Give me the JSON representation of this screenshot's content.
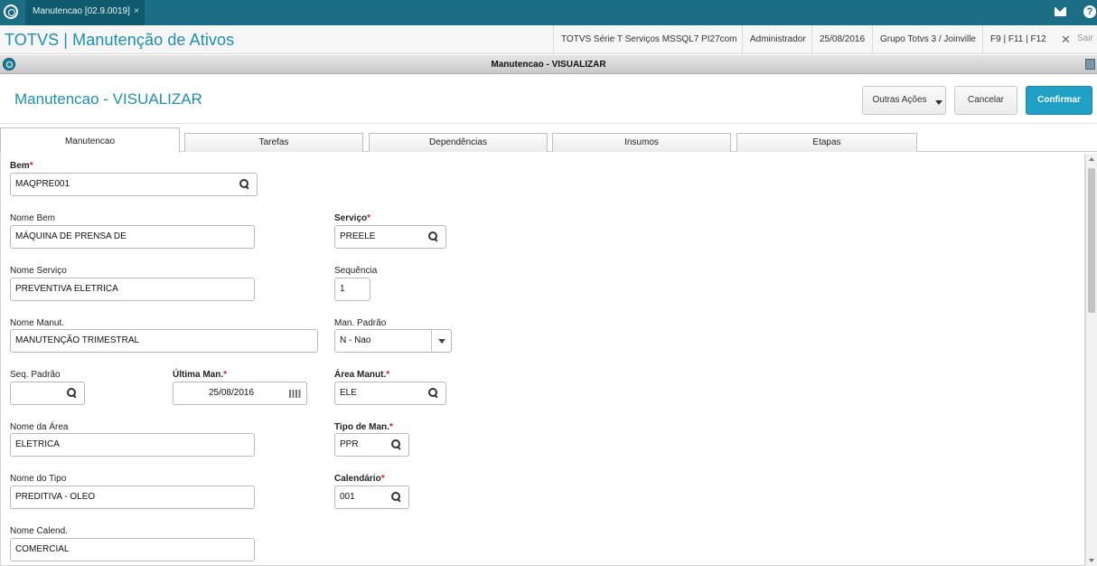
{
  "topbar": {
    "tab_label": "Manutencao [02.9.0019]",
    "tab_close": "×"
  },
  "titlebar": {
    "app_title": "TOTVS | Manutenção de Ativos",
    "environment": "TOTVS Série T Serviços MSSQL7 PI27com",
    "user": "Administrador",
    "date": "25/08/2016",
    "company": "Grupo Totvs 3 / Joinville",
    "shortcuts": "F9 | F11 | F12",
    "close_glyph": "✕",
    "exit_label": "Sair"
  },
  "dialog": {
    "caption": "Manutencao - VISUALIZAR"
  },
  "header": {
    "title": "Manutencao - VISUALIZAR",
    "other_actions": "Outras Ações",
    "cancel": "Cancelar",
    "confirm": "Confirmar"
  },
  "tabs": [
    "Manutencao",
    "Tarefas",
    "Dependências",
    "Insumos",
    "Etapas"
  ],
  "form": {
    "bem": {
      "label": "Bem",
      "value": "MAQPRE001"
    },
    "nome_bem": {
      "label": "Nome Bem",
      "value": "MÁQUINA DE PRENSA DE"
    },
    "servico": {
      "label": "Serviço",
      "value": "PREELE"
    },
    "nome_servico": {
      "label": "Nome Serviço",
      "value": "PREVENTIVA ELETRICA"
    },
    "sequencia": {
      "label": "Sequência",
      "value": "1"
    },
    "nome_manut": {
      "label": "Nome Manut.",
      "value": "MANUTENÇÃO TRIMESTRAL"
    },
    "man_padrao": {
      "label": "Man. Padrão",
      "value": "N - Nao"
    },
    "seq_padrao": {
      "label": "Seq. Padrão",
      "value": ""
    },
    "ultima_man": {
      "label": "Última Man.",
      "value": "25/08/2016"
    },
    "area_manut": {
      "label": "Área Manut.",
      "value": "ELE"
    },
    "nome_area": {
      "label": "Nome da Área",
      "value": "ELETRICA"
    },
    "tipo_man": {
      "label": "Tipo de Man.",
      "value": "PPR"
    },
    "nome_tipo": {
      "label": "Nome do Tipo",
      "value": "PREDITIVA - OLEO"
    },
    "calendario": {
      "label": "Calendário",
      "value": "001"
    },
    "nome_calend": {
      "label": "Nome Calend.",
      "value": "COMERCIAL"
    },
    "required_marker": "*"
  },
  "colors": {
    "brand": "#1b6e84",
    "accent": "#1e8fae",
    "confirm": "#1fa0c4",
    "required": "#d21f1f"
  }
}
